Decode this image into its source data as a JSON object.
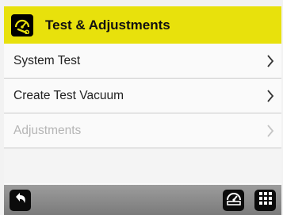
{
  "header": {
    "title": "Test & Adjustments",
    "icon": "gauge-wrench-icon",
    "color": "#e8e10c"
  },
  "menu": {
    "items": [
      {
        "label": "System Test",
        "enabled": true
      },
      {
        "label": "Create Test Vacuum",
        "enabled": true
      },
      {
        "label": "Adjustments",
        "enabled": false
      }
    ]
  },
  "footer": {
    "back_icon": "back-arrow-icon",
    "gauge_icon": "gauge-icon",
    "menu_icon": "grid-menu-icon"
  }
}
